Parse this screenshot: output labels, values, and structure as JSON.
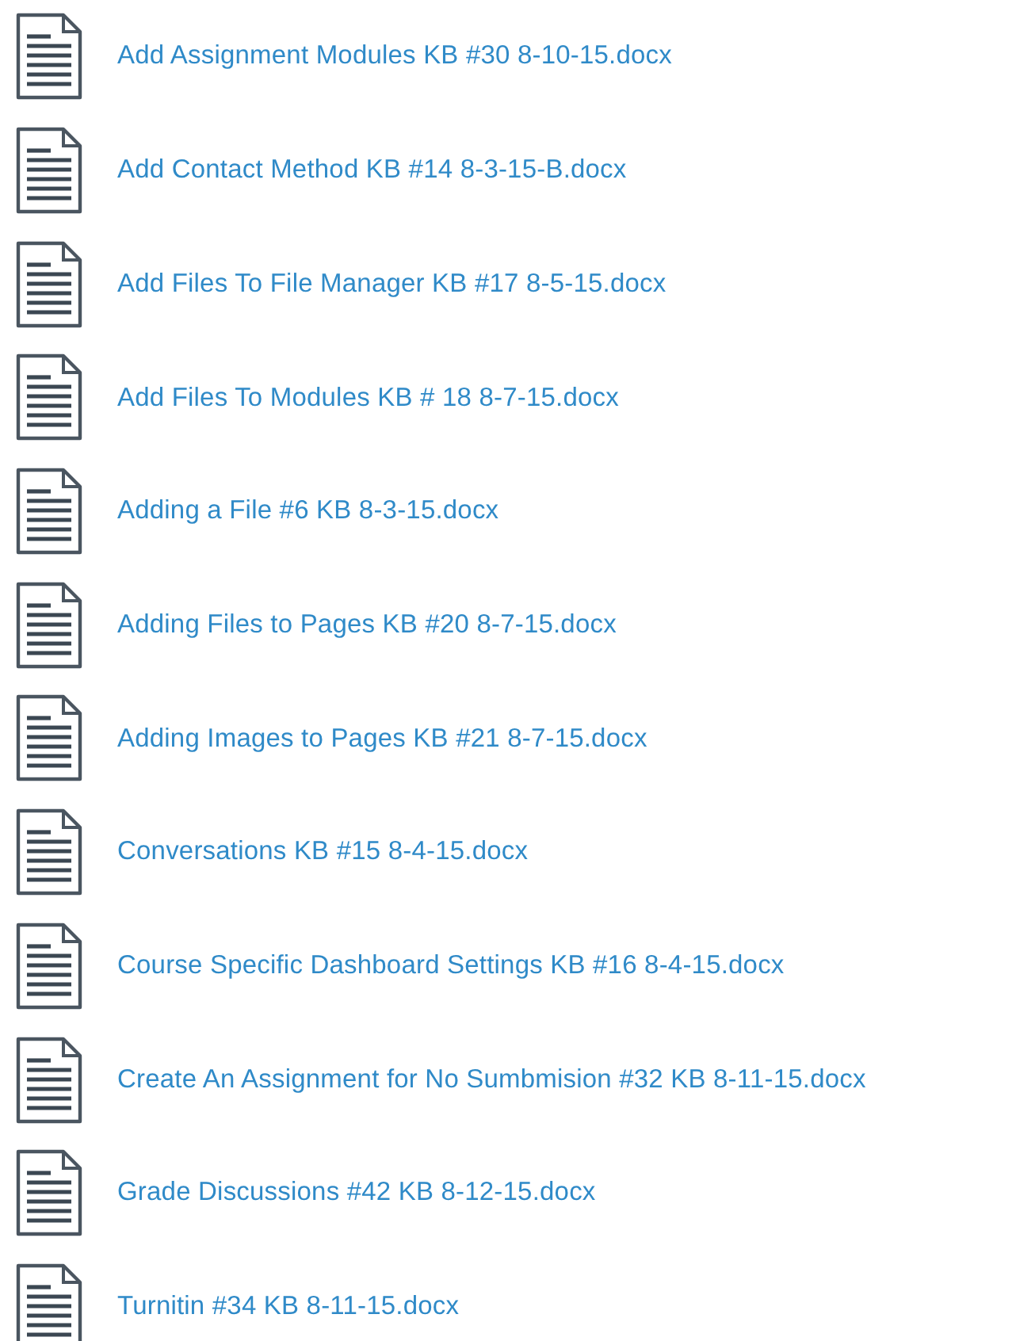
{
  "files": [
    {
      "name": "Add Assignment Modules KB #30 8-10-15.docx"
    },
    {
      "name": "Add Contact Method KB #14 8-3-15-B.docx"
    },
    {
      "name": "Add Files To File Manager KB #17 8-5-15.docx"
    },
    {
      "name": "Add Files To Modules KB # 18 8-7-15.docx"
    },
    {
      "name": "Adding a File #6 KB 8-3-15.docx"
    },
    {
      "name": "Adding Files to Pages KB #20 8-7-15.docx"
    },
    {
      "name": "Adding Images to Pages KB #21 8-7-15.docx"
    },
    {
      "name": "Conversations KB #15 8-4-15.docx"
    },
    {
      "name": "Course Specific Dashboard Settings KB #16 8-4-15.docx"
    },
    {
      "name": "Create An Assignment for No Sumbmision #32 KB 8-11-15.docx"
    },
    {
      "name": "Grade Discussions #42 KB 8-12-15.docx"
    },
    {
      "name": "Turnitin #34 KB 8-11-15.docx"
    }
  ]
}
